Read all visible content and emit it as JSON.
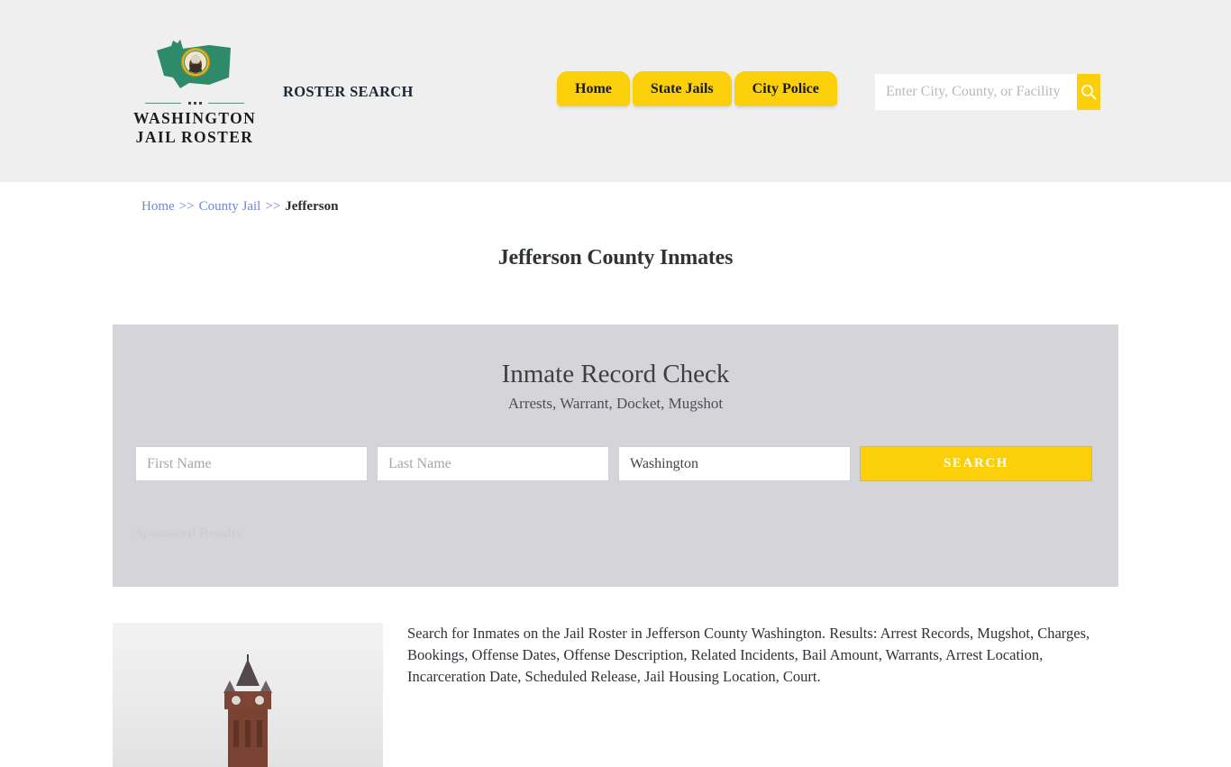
{
  "site": {
    "logo_line1": "WASHINGTON",
    "logo_line2": "JAIL ROSTER",
    "tagline": "ROSTER SEARCH",
    "accent_yellow": "#fbd00a",
    "logo_green": "#2f8a6a",
    "header_bg": "#efefef"
  },
  "nav": {
    "items": [
      {
        "label": "Home"
      },
      {
        "label": "State Jails"
      },
      {
        "label": "City Police"
      }
    ]
  },
  "header_search": {
    "placeholder": "Enter City, County, or Facility",
    "value": "",
    "icon": "search-icon"
  },
  "breadcrumb": {
    "home": "Home",
    "sep1": ">>",
    "county_jail": "County Jail",
    "sep2": ">>",
    "current": "Jefferson"
  },
  "page": {
    "title": "Jefferson County Inmates"
  },
  "record_check": {
    "title": "Inmate Record Check",
    "subtitle": "Arrests, Warrant, Docket, Mugshot",
    "first_name_placeholder": "First Name",
    "first_name_value": "",
    "last_name_placeholder": "Last Name",
    "last_name_value": "",
    "state_selected": "Washington",
    "state_options": [
      "Washington"
    ],
    "search_label": "SEARCH",
    "sponsored_label": "Sponsored Results",
    "panel_bg": "#d4d4d9"
  },
  "content": {
    "photo_alt": "clock-tower-courthouse-photo",
    "description": "Search for Inmates on the Jail Roster in Jefferson County Washington. Results: Arrest Records, Mugshot, Charges, Bookings, Offense Dates, Offense Description, Related Incidents, Bail Amount, Warrants, Arrest Location, Incarceration Date, Scheduled Release, Jail Housing Location, Court."
  }
}
